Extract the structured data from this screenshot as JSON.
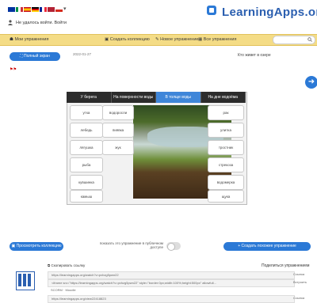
{
  "header": {
    "logo_text": "LearningApps.org",
    "user_text": "Не удалось войти. Войти",
    "language_chevron": "▾",
    "flag_colors": [
      "#0033a0",
      "#ffffff",
      "#d52b1e",
      "#009246",
      "#ffce00",
      "#002395",
      "#ffffff",
      "#c60b1e"
    ]
  },
  "toolbar": {
    "items": [
      {
        "label": "Все упражнения",
        "icon": "grid-icon"
      },
      {
        "label": "Новое упражнение",
        "icon": "plus-icon"
      },
      {
        "label": "Создать коллекцию",
        "icon": "folder-icon"
      },
      {
        "label": "Мои упражнения",
        "icon": "user-icon"
      }
    ]
  },
  "page": {
    "breadcrumb": "Кто живет в озере",
    "date": "2022-01-27",
    "fullscreen_label": "Полный экран",
    "next_symbol": "➜"
  },
  "app": {
    "tabs": [
      "У берега",
      "На поверхности воды",
      "В толще воды",
      "На дне водоёма"
    ],
    "active_tab": 2,
    "pieces_left": [
      "утка",
      "лебедь",
      "лягушка",
      "рыба",
      "кувшинка",
      "камыш"
    ],
    "pieces_right": [
      "рак",
      "улитка",
      "тростник",
      "стрекоза",
      "водомерка",
      "щука"
    ],
    "pieces_top": [
      "водоросли",
      "пиявка",
      "жук"
    ]
  },
  "controls": {
    "create_label": "Создать похожее упражнение",
    "preview_label": "Просмотреть коллекцию",
    "toggle_text": "показать это упражнение в публичном доступе",
    "toggle_on": false
  },
  "share": {
    "title": "Поделиться упражнением",
    "copy_label": "Скопировать ссылку",
    "rows": [
      {
        "label": "Ссылка",
        "value": "https://learningapps.org/watch?v=pxhzg5pwn22"
      },
      {
        "label": "Встроить",
        "value": "<iframe src=\"https://learningapps.org/watch?v=pxhzg5pwn22\" style=\"border:0px;width:100%;height:500px\" allowfull..."
      },
      {
        "label": "",
        "value": "SCORM  ·  Moodle"
      },
      {
        "label": "Ссылка",
        "value": "https://learningapps.org/view22418823"
      }
    ]
  }
}
